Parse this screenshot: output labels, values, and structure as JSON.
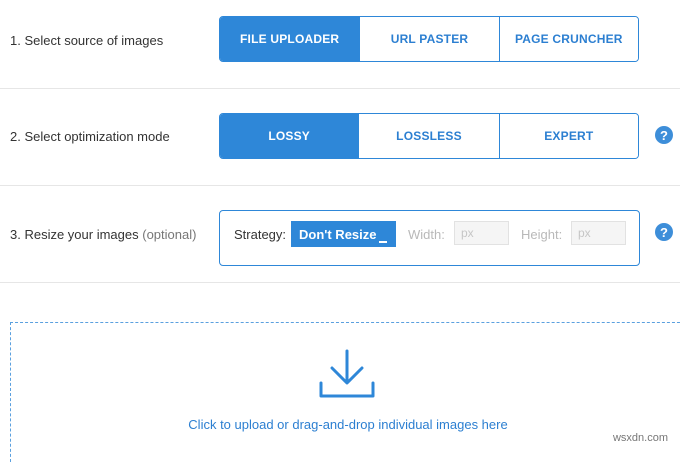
{
  "step1": {
    "label": "1. Select source of images",
    "options": [
      "FILE UPLOADER",
      "URL PASTER",
      "PAGE CRUNCHER"
    ],
    "active": "FILE UPLOADER"
  },
  "step2": {
    "label": "2. Select optimization mode",
    "options": [
      "LOSSY",
      "LOSSLESS",
      "EXPERT"
    ],
    "active": "LOSSY",
    "help": "?"
  },
  "step3": {
    "label": "3. Resize your images",
    "label_optional": "(optional)",
    "strategy_label": "Strategy:",
    "strategy_value": "Don't Resize",
    "width_label": "Width:",
    "width_placeholder": "px",
    "height_label": "Height:",
    "height_placeholder": "px",
    "help": "?"
  },
  "upload": {
    "icon": "download-arrow-icon",
    "text": "Click to upload or drag-and-drop individual images here"
  },
  "watermark": "wsxdn.com",
  "colors": {
    "accent": "#2e87d8",
    "link": "#2c7fd1",
    "help_icon": "#3d8ed9"
  }
}
